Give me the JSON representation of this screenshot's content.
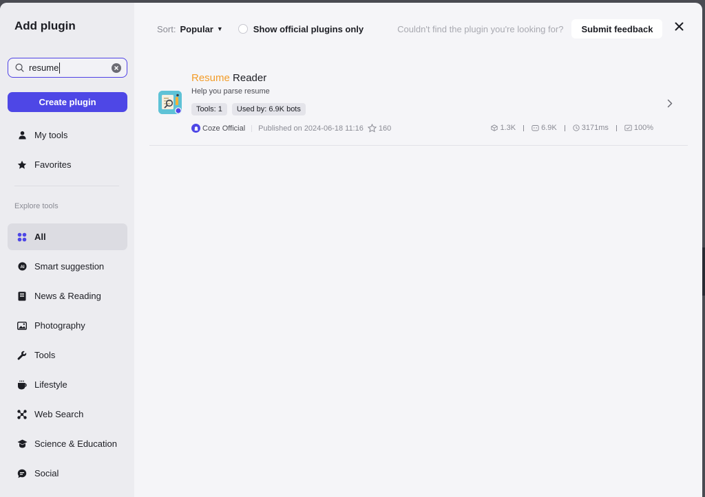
{
  "sidebar": {
    "title": "Add plugin",
    "search": {
      "value": "resume",
      "placeholder": ""
    },
    "create_label": "Create plugin",
    "my_items": [
      {
        "label": "My tools",
        "icon": "person-icon"
      },
      {
        "label": "Favorites",
        "icon": "star-icon"
      }
    ],
    "explore_label": "Explore tools",
    "categories": [
      {
        "label": "All",
        "icon": "grid-icon",
        "active": true
      },
      {
        "label": "Smart suggestion",
        "icon": "ai-icon"
      },
      {
        "label": "News & Reading",
        "icon": "book-icon"
      },
      {
        "label": "Photography",
        "icon": "image-icon"
      },
      {
        "label": "Tools",
        "icon": "wrench-icon"
      },
      {
        "label": "Lifestyle",
        "icon": "cup-icon"
      },
      {
        "label": "Web Search",
        "icon": "network-icon"
      },
      {
        "label": "Science & Education",
        "icon": "graduation-cap-icon"
      },
      {
        "label": "Social",
        "icon": "chat-icon"
      }
    ]
  },
  "topbar": {
    "sort_label": "Sort:",
    "sort_value": "Popular",
    "official_label": "Show official plugins only",
    "hint": "Couldn't find the plugin you're looking for?",
    "feedback_label": "Submit feedback"
  },
  "plugins": [
    {
      "title_highlight": "Resume",
      "title_rest": " Reader",
      "description": "Help you parse resume",
      "tags": [
        "Tools: 1",
        "Used by: 6.9K bots"
      ],
      "author": "Coze Official",
      "published": "Published on 2024-06-18 11:16",
      "favorites": "160",
      "stats": {
        "bots": "1.3K",
        "calls": "6.9K",
        "latency": "3171ms",
        "success": "100%"
      }
    }
  ],
  "colors": {
    "accent": "#4e47e6",
    "highlight": "#f39c28",
    "sidebar_bg": "#ececf0",
    "main_bg": "#f5f5f8"
  }
}
